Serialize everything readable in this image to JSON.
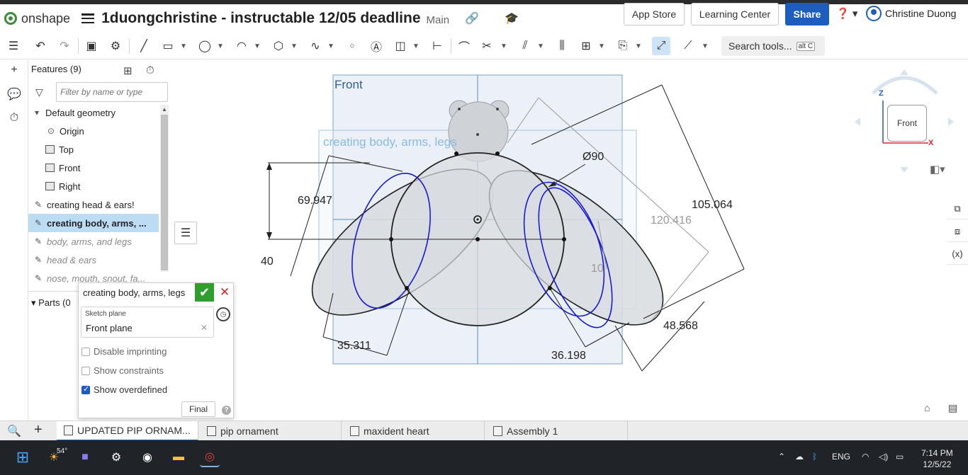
{
  "app": {
    "brand": "onshape",
    "document_title": "1duongchristine - instructable 12/05 deadline",
    "workspace": "Main"
  },
  "header": {
    "app_store": "App Store",
    "learning_center": "Learning Center",
    "share": "Share",
    "user_name": "Christine Duong"
  },
  "toolbar": {
    "search_label": "Search tools...",
    "search_shortcut": "alt C"
  },
  "feature_panel": {
    "title": "Features (9)",
    "filter_placeholder": "Filter by name or type",
    "default_geometry": "Default geometry",
    "items": [
      {
        "label": "Origin"
      },
      {
        "label": "Top"
      },
      {
        "label": "Front"
      },
      {
        "label": "Right"
      },
      {
        "label": "creating head & ears!"
      },
      {
        "label": "creating body, arms, ..."
      },
      {
        "label": "body, arms, and legs"
      },
      {
        "label": "head & ears"
      },
      {
        "label": "nose, mouth, snout, fa..."
      }
    ],
    "parts_label": "Parts (0"
  },
  "sketch_dialog": {
    "title": "creating body, arms, legs",
    "sketch_plane_label": "Sketch plane",
    "sketch_plane_value": "Front plane",
    "disable_imprinting": "Disable imprinting",
    "show_constraints": "Show constraints",
    "show_overdefined": "Show overdefined",
    "final": "Final"
  },
  "viewport": {
    "plane_label": "Front",
    "sketch_label": "creating body, arms, legs",
    "dimensions": [
      "69.947",
      "40",
      "35.311",
      "Ø90",
      "105.064",
      "120.416",
      "10",
      "48.568",
      "36.198"
    ]
  },
  "view_cube": {
    "face": "Front",
    "axis_z": "Z",
    "axis_x": "X"
  },
  "tabs": [
    {
      "label": "UPDATED PIP ORNAM..."
    },
    {
      "label": "pip ornament"
    },
    {
      "label": "maxident heart"
    },
    {
      "label": "Assembly 1"
    }
  ],
  "taskbar": {
    "weather": "54°",
    "language": "ENG",
    "time": "7:14 PM",
    "date": "12/5/22"
  },
  "colors": {
    "accent": "#1c5dbe",
    "confirm": "#2e9e2e",
    "cancel": "#d42828",
    "selected_row": "#bcdcf3",
    "sketch_blue": "#1a1ad6",
    "plane_fill": "#dbe6f0"
  }
}
